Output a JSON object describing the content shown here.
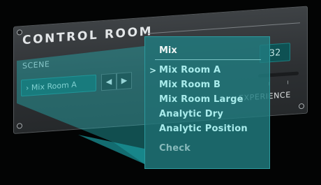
{
  "panel": {
    "title": "CONTROL ROOM",
    "scene_label": "SCENE",
    "scene_value": "Mix Room A",
    "prev_icon": "triangle-left",
    "next_icon": "triangle-right",
    "value_readout": "32",
    "experience_label": "EXPERIENCE"
  },
  "menu": {
    "heading": "Mix",
    "selected_marker": ">",
    "items": [
      {
        "label": "Mix Room A"
      },
      {
        "label": "Mix Room B"
      },
      {
        "label": "Mix Room Large"
      },
      {
        "label": "Analytic Dry"
      },
      {
        "label": "Analytic Position"
      }
    ],
    "check_label": "Check"
  },
  "colors": {
    "accent_teal": "#217c80",
    "field_teal": "#0e5153",
    "menu_text": "#a9ecec",
    "background": "#030404"
  }
}
